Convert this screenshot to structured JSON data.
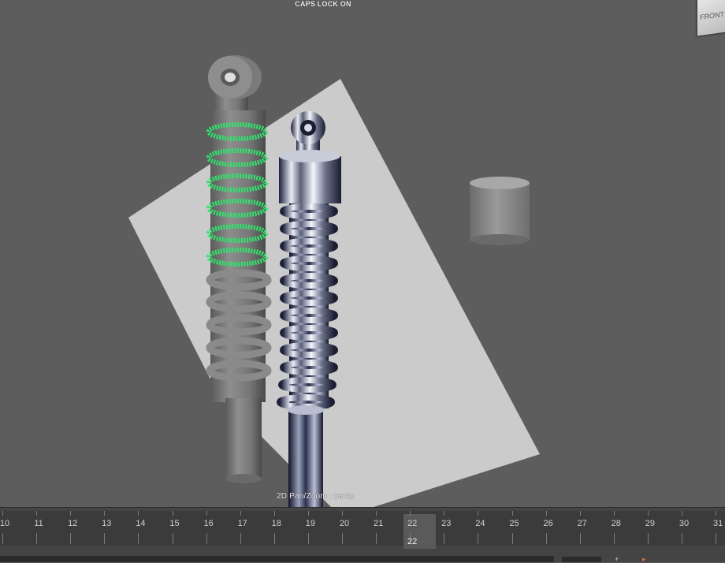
{
  "viewport": {
    "caps_lock_text": "CAPS LOCK ON",
    "camera_status": "2D Pan/Zoom : persp",
    "view_cube_label": "FRONT"
  },
  "timeline": {
    "frames": [
      "10",
      "11",
      "12",
      "13",
      "14",
      "15",
      "16",
      "17",
      "18",
      "19",
      "20",
      "21",
      "22",
      "23",
      "24",
      "25",
      "26",
      "27",
      "28",
      "29",
      "30",
      "31"
    ],
    "current_frame": "22"
  },
  "colors": {
    "viewport_bg": "#5d5d5d",
    "selection_wireframe": "#2ee66b",
    "timeline_bg": "#3b3b3b",
    "current_frame_highlight": "#5a5a5a"
  },
  "icons": [
    "view-cube-icon",
    "key-icon",
    "playback-icon"
  ]
}
